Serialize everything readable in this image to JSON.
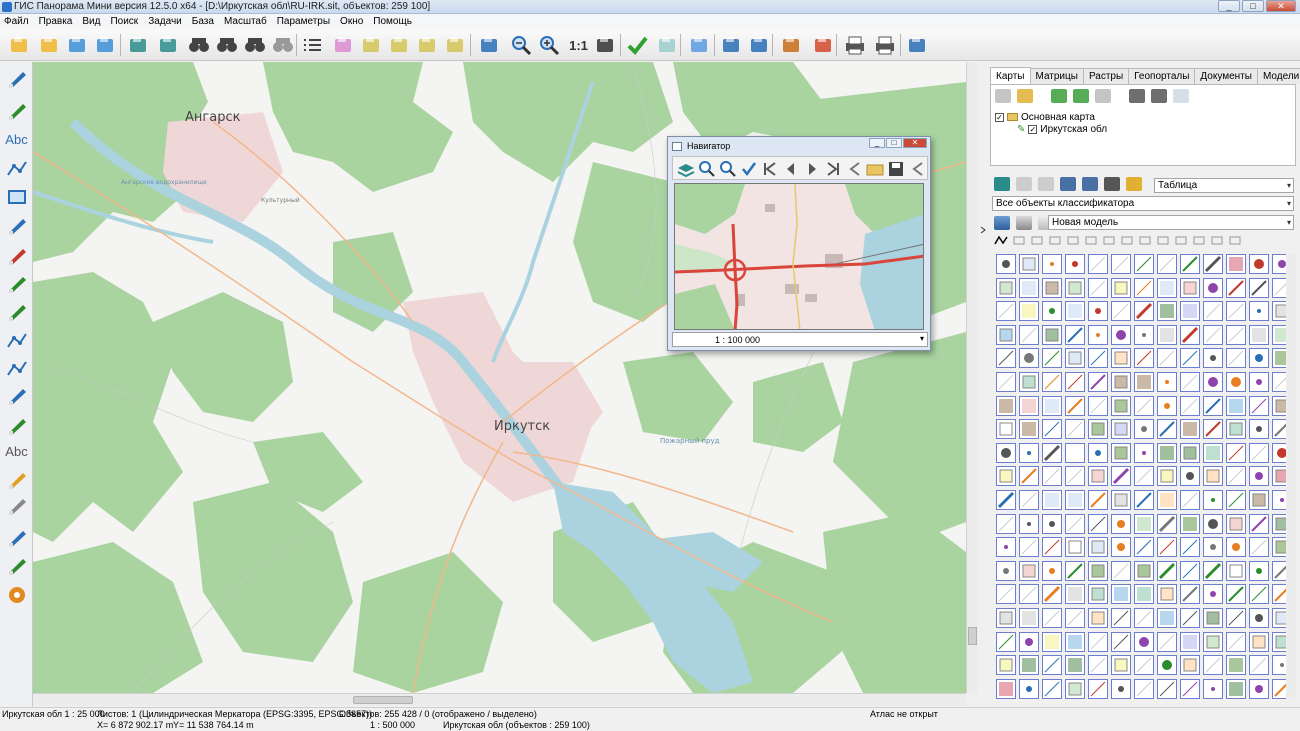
{
  "window": {
    "title": "ГИС Панорама Мини версия 12.5.0 x64 - [D:\\Иркутская обл\\RU-IRK.sit, объектов: 259 100]",
    "min": "_",
    "max": "□",
    "close": "✕"
  },
  "menu": [
    "Файл",
    "Правка",
    "Вид",
    "Поиск",
    "Задачи",
    "База",
    "Масштаб",
    "Параметры",
    "Окно",
    "Помощь"
  ],
  "toolbar": {
    "scale_1to1": "1:1",
    "icons": [
      "open-icon",
      "open-multi-icon",
      "open-globe-icon",
      "open-globe-doc-icon",
      "layers-icon",
      "layers-zoom-icon",
      "binoculars-icon",
      "binoculars-a-icon",
      "binoculars-more-icon",
      "binoculars-gray-icon",
      "list-icon",
      "select-area-icon",
      "select-rect-icon",
      "select-add-icon",
      "select-point-icon",
      "deselect-icon",
      "window-icon",
      "zoom-out-icon",
      "zoom-in-icon",
      "scale-1to1-icon",
      "fit-icon",
      "apply-icon",
      "back-icon",
      "pointer-icon",
      "table-cursor-icon",
      "table-a-icon",
      "settings-brush-icon",
      "marker-pin-icon",
      "print-icon",
      "print-settings-icon",
      "help-pointer-icon"
    ]
  },
  "left_toolbar": {
    "abc1": "Abc",
    "abc2": "Abc",
    "icons": [
      "draw-line-icon",
      "edit-line-icon",
      "text-icon",
      "polyline-icon",
      "rectangle-icon",
      "star-icon",
      "delete-object-icon",
      "delete-points-icon",
      "move-object-icon",
      "split-line-icon",
      "curve-icon",
      "scissors-icon",
      "copy-objects-icon",
      "signature-icon",
      "ruler-icon",
      "eraser-icon",
      "undo-icon",
      "database-icon",
      "settings-gear-icon"
    ]
  },
  "map": {
    "cities": [
      {
        "name": "Ангарск"
      },
      {
        "name": "Иркутск"
      }
    ],
    "small_labels": [
      "Пожарный пруд",
      "Ангарское водохранилище",
      "Культурный"
    ]
  },
  "navigator": {
    "title": "Навигатор",
    "scale": "1 : 100 000",
    "icons": [
      "nav-layers-icon",
      "nav-zoom-out-icon",
      "nav-zoom-in-icon",
      "nav-check-icon",
      "nav-first-icon",
      "nav-prev-icon",
      "nav-next-icon",
      "nav-last-icon",
      "nav-back-icon",
      "nav-open-icon",
      "nav-save-icon",
      "nav-settings-icon"
    ]
  },
  "right_panel": {
    "tabs": [
      "Карты",
      "Матрицы",
      "Растры",
      "Геопорталы",
      "Документы",
      "Модели"
    ],
    "active_tab": "Карты",
    "tree": [
      {
        "label": "Основная карта",
        "checked": true
      },
      {
        "label": "Иркутская обл",
        "checked": true
      }
    ],
    "view_combo": "Таблица",
    "classifier_combo": "Все объекты классификатора",
    "model_combo": "Новая модель"
  },
  "status": {
    "scale_info": "Иркутская обл  1 : 25 000",
    "sheets": "Листов: 1",
    "projection": "(Цилиндрическая Меркатора (EPSG:3395, EPSG:3857))",
    "objects": "Объектов: 255 428 / 0 (отображено / выделено)",
    "atlas": "Атлас не открыт",
    "x": "X= 6 872 902.17 m",
    "y": "Y= 11 538 764.14 m",
    "scale": "1 : 500 000",
    "map_objects": "Иркутская обл   (объектов : 259 100)"
  },
  "colors": {
    "forest": "#a9d4a0",
    "water": "#aad3df",
    "urban": "#f2dcdc",
    "road": "#f3b78c",
    "palette_border": "#6b7ed0"
  }
}
